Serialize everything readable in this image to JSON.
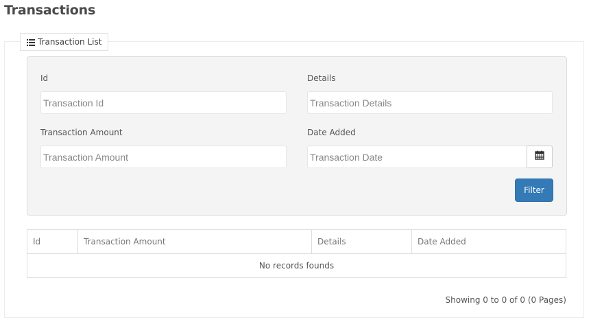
{
  "page": {
    "title": "Transactions"
  },
  "panel": {
    "tab_label": "Transaction List",
    "tab_icon": "list-icon"
  },
  "filters": {
    "id": {
      "label": "Id",
      "placeholder": "Transaction Id",
      "value": ""
    },
    "details": {
      "label": "Details",
      "placeholder": "Transaction Details",
      "value": ""
    },
    "amount": {
      "label": "Transaction Amount",
      "placeholder": "Transaction Amount",
      "value": ""
    },
    "date": {
      "label": "Date Added",
      "placeholder": "Transaction Date",
      "value": "",
      "button_icon": "calendar-icon"
    },
    "filter_label": "Filter"
  },
  "table": {
    "columns": [
      "Id",
      "Transaction Amount",
      "Details",
      "Date Added"
    ],
    "rows": [],
    "empty_message": "No records founds"
  },
  "pagination": {
    "summary": "Showing 0 to 0 of 0 (0 Pages)"
  },
  "colors": {
    "primary_button": "#337ab7",
    "filter_background": "#f4f4f4"
  }
}
